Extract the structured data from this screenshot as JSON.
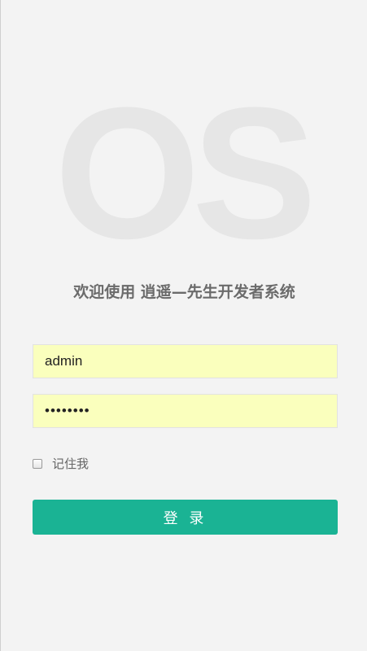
{
  "logo": {
    "text": "OS"
  },
  "title": "欢迎使用 逍遥—先生开发者系统",
  "form": {
    "username": {
      "value": "admin"
    },
    "password": {
      "value": "••••••••"
    },
    "remember": {
      "label": "记住我",
      "checked": false
    },
    "submit_label": "登 录"
  },
  "colors": {
    "background": "#f3f3f3",
    "autofill": "#faffbd",
    "accent": "#1ab394",
    "title": "#6b6b6b"
  }
}
